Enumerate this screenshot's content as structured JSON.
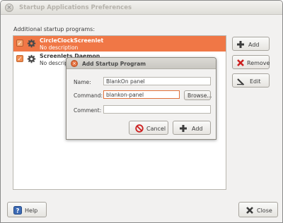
{
  "window": {
    "title": "Startup Applications Preferences"
  },
  "section_label": "Additional startup programs:",
  "programs": [
    {
      "title": "CircleClockScreenlet",
      "description": "No description",
      "enabled": true,
      "selected": true
    },
    {
      "title": "Screenlets Daemon",
      "description": "No description",
      "enabled": true,
      "selected": false
    }
  ],
  "side_buttons": {
    "add": "Add",
    "remove": "Remove",
    "edit": "Edit"
  },
  "footer": {
    "help": "Help",
    "close": "Close"
  },
  "dialog": {
    "title": "Add Startup Program",
    "name_label": "Name:",
    "name_value": "BlankOn panel",
    "command_label": "Command:",
    "command_value": "blankon-panel",
    "comment_label": "Comment:",
    "comment_value": "",
    "browse": "Browse...",
    "cancel": "Cancel",
    "add": "Add"
  },
  "colors": {
    "selection": "#f07746",
    "remove_icon": "#cc1f1f",
    "focus_border": "#e0703a"
  },
  "icons": [
    "close-icon",
    "checkbox-icon",
    "gear-icon",
    "plus-icon",
    "remove-x-icon",
    "edit-pencil-icon",
    "help-icon",
    "cancel-icon"
  ]
}
